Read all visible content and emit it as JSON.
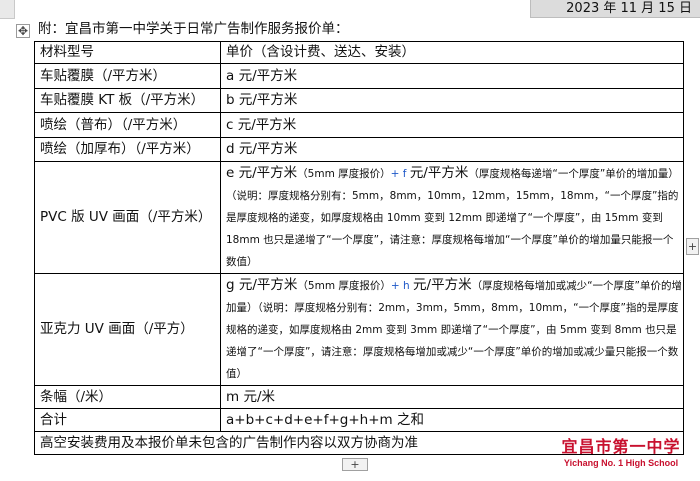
{
  "header": {
    "date": "2023 年 11 月 15 日"
  },
  "title": "附：宜昌市第一中学关于日常广告制作服务报价单：",
  "table": {
    "col_header_type": "材料型号",
    "col_header_price": "单价（含设计费、送达、安装）",
    "rows": [
      {
        "type": "车贴覆膜（/平方米）",
        "price": "a 元/平方米"
      },
      {
        "type": "车贴覆膜 KT 板（/平方米）",
        "price": "b 元/平方米"
      },
      {
        "type": "喷绘（普布）（/平方米）",
        "price": "c 元/平方米"
      },
      {
        "type": "喷绘（加厚布）（/平方米）",
        "price": "d 元/平方米"
      },
      {
        "type": "PVC 版 UV 画面（/平方米）",
        "price_big1": "e 元/平方米",
        "price_small1": "（5mm 厚度报价）",
        "price_plus_f": "+ f ",
        "price_big2": "元/平方米",
        "price_small2": "（厚度规格每递增“一个厚度”单价的增加量）        （说明：厚度规格分别有：5mm，8mm，10mm，12mm，15mm，18mm，“一个厚度”指的是厚度规格的递变，如厚度规格由 10mm 变到 12mm 即递增了“一个厚度”，由 15mm 变到 18mm 也只是递增了“一个厚度”，请注意：厚度规格每增加“一个厚度”单价的增加量只能报一个数值）"
      },
      {
        "type": "亚克力 UV 画面（/平方）",
        "price_big1": "g 元/平方米",
        "price_small1": "（5mm 厚度报价）",
        "price_plus_h": "+ h ",
        "price_big2": "元/平方米",
        "price_small2": "（厚度规格每增加或减少“一个厚度”单价的增加量）（说明：厚度规格分别有：2mm，3mm，5mm，8mm，10mm，“一个厚度”指的是厚度规格的递变，如厚度规格由 2mm 变到 3mm 即递增了“一个厚度”，由 5mm 变到 8mm 也只是递增了“一个厚度”，请注意：厚度规格每增加或减少“一个厚度”单价的增加或减少量只能报一个数值）"
      },
      {
        "type": "条幅（/米）",
        "price": "m 元/米"
      },
      {
        "type": "合计",
        "price": "a+b+c+d+e+f+g+h+m 之和"
      }
    ],
    "footer_note": "高空安装费用及本报价单未包含的广告制作内容以双方协商为准"
  },
  "logo": {
    "name_cn": "宜昌市第一中学",
    "name_en": "Yichang No. 1 High School"
  },
  "controls": {
    "move_icon": "move-icon",
    "add_row": "+",
    "add_col": "+"
  },
  "colors": {
    "accent_blue": "#1e58c8",
    "logo_red": "#c8102e"
  }
}
